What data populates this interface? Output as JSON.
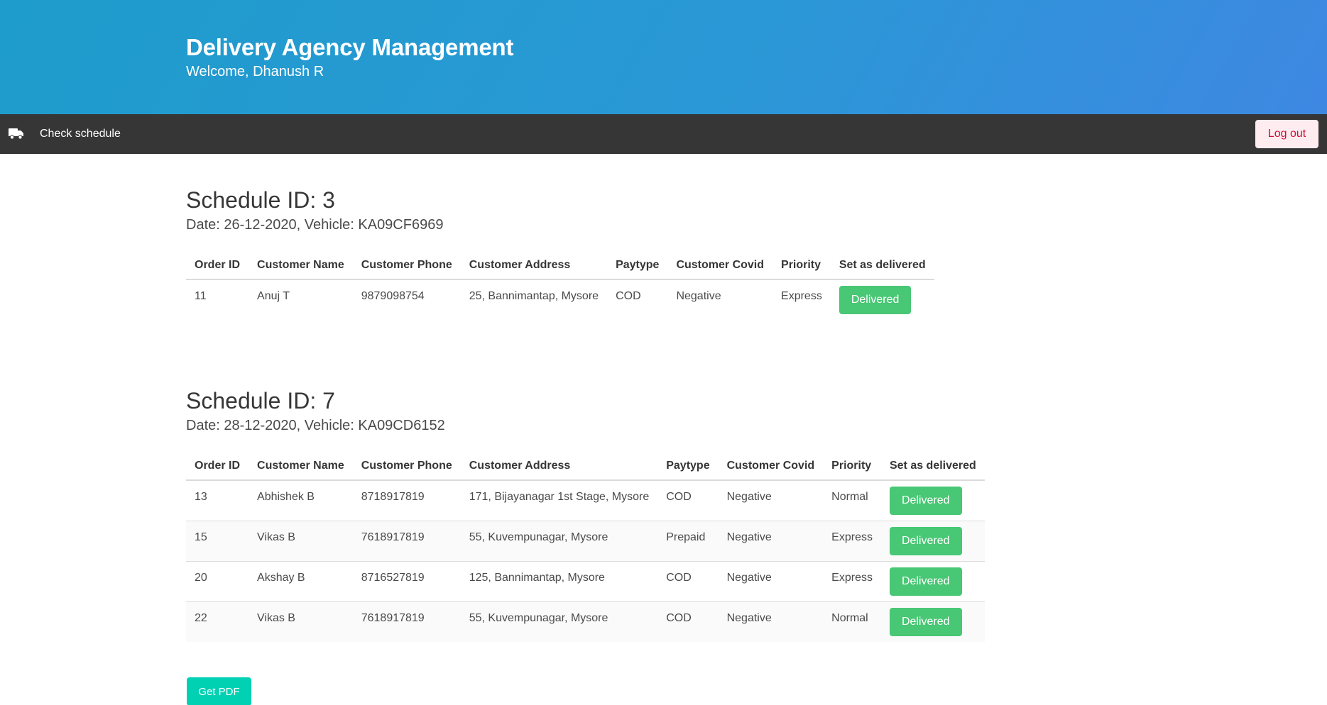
{
  "header": {
    "title": "Delivery Agency Management",
    "subtitle": "Welcome, Dhanush R"
  },
  "nav": {
    "item_label": "Check schedule",
    "item_icon": "truck-icon",
    "logout_label": "Log out"
  },
  "table_headers": [
    "Order ID",
    "Customer Name",
    "Customer Phone",
    "Customer Address",
    "Paytype",
    "Customer Covid",
    "Priority",
    "Set as delivered"
  ],
  "schedules": [
    {
      "title": "Schedule ID: 3",
      "meta": "Date: 26-12-2020, Vehicle: KA09CF6969",
      "rows": [
        {
          "order_id": "11",
          "name": "Anuj T",
          "phone": "9879098754",
          "address": "25, Bannimantap, Mysore",
          "paytype": "COD",
          "covid": "Negative",
          "priority": "Express",
          "action": "Delivered"
        }
      ]
    },
    {
      "title": "Schedule ID: 7",
      "meta": "Date: 28-12-2020, Vehicle: KA09CD6152",
      "rows": [
        {
          "order_id": "13",
          "name": "Abhishek B",
          "phone": "8718917819",
          "address": "171, Bijayanagar 1st Stage, Mysore",
          "paytype": "COD",
          "covid": "Negative",
          "priority": "Normal",
          "action": "Delivered"
        },
        {
          "order_id": "15",
          "name": "Vikas B",
          "phone": "7618917819",
          "address": "55, Kuvempunagar, Mysore",
          "paytype": "Prepaid",
          "covid": "Negative",
          "priority": "Express",
          "action": "Delivered"
        },
        {
          "order_id": "20",
          "name": "Akshay B",
          "phone": "8716527819",
          "address": "125, Bannimantap, Mysore",
          "paytype": "COD",
          "covid": "Negative",
          "priority": "Express",
          "action": "Delivered"
        },
        {
          "order_id": "22",
          "name": "Vikas B",
          "phone": "7618917819",
          "address": "55, Kuvempunagar, Mysore",
          "paytype": "COD",
          "covid": "Negative",
          "priority": "Normal",
          "action": "Delivered"
        }
      ]
    }
  ],
  "pdf_button_label": "Get PDF",
  "colors": {
    "hero_start": "#1e9ccb",
    "hero_end": "#3e88e2",
    "navbar": "#363636",
    "delivered_button": "#48c774",
    "pdf_button": "#00d1b2",
    "logout_text": "#cc0f35",
    "logout_bg": "#feecf0"
  }
}
